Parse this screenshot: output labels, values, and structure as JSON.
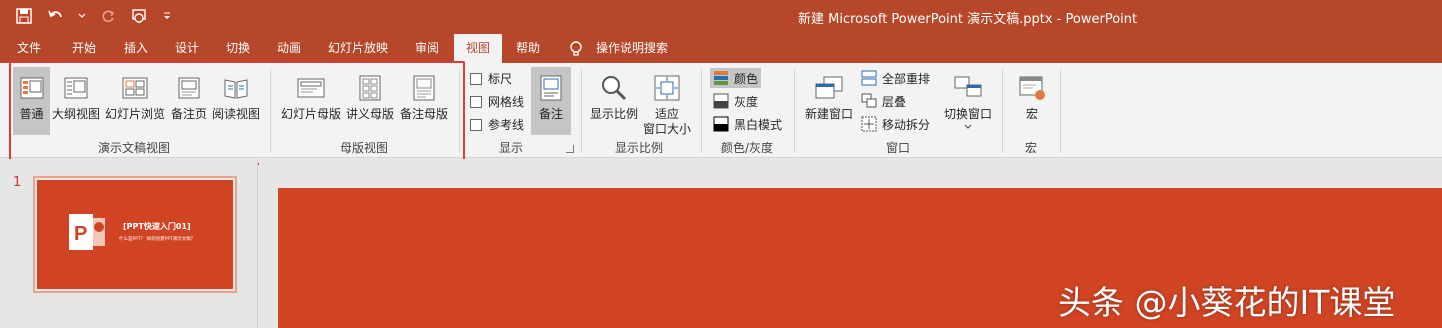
{
  "titlebar": {
    "title": "新建 Microsoft PowerPoint 演示文稿.pptx  -  PowerPoint",
    "qat": [
      "save-icon",
      "undo-icon",
      "redo-icon",
      "start-from-beginning-icon",
      "customize-qat-icon"
    ]
  },
  "tabs": [
    "文件",
    "开始",
    "插入",
    "设计",
    "切换",
    "动画",
    "幻灯片放映",
    "审阅",
    "视图",
    "帮助"
  ],
  "active_tab": "视图",
  "search": {
    "label": "操作说明搜索"
  },
  "ribbon": {
    "presentation_views": {
      "label": "演示文稿视图",
      "buttons": [
        "普通",
        "大纲视图",
        "幻灯片浏览",
        "备注页",
        "阅读视图"
      ],
      "selected": "普通"
    },
    "master_views": {
      "label": "母版视图",
      "buttons": [
        "幻灯片母版",
        "讲义母版",
        "备注母版"
      ]
    },
    "show": {
      "label": "显示",
      "checkboxes": [
        "标尺",
        "网格线",
        "参考线"
      ],
      "notes_button": "备注"
    },
    "zoom": {
      "label": "显示比例",
      "zoom_button": "显示比例",
      "fit_line1": "适应",
      "fit_line2": "窗口大小"
    },
    "color": {
      "label": "颜色/灰度",
      "options": [
        "颜色",
        "灰度",
        "黑白模式"
      ],
      "selected": "颜色"
    },
    "window": {
      "label": "窗口",
      "new_window": "新建窗口",
      "arrange_all": "全部重排",
      "cascade": "层叠",
      "move_split": "移动拆分",
      "switch_window": "切换窗口"
    },
    "macros": {
      "label": "宏",
      "button": "宏"
    }
  },
  "thumbnails": {
    "number": "1",
    "title": "[PPT快速入门01]",
    "subtitle": "什么是PPT？ 如何创建PPT演示文稿?"
  },
  "watermark": "头条 @小葵花的IT课堂",
  "colors": {
    "accent": "#b7472a",
    "slide": "#d04423",
    "highlight_box": "#e0393a"
  }
}
